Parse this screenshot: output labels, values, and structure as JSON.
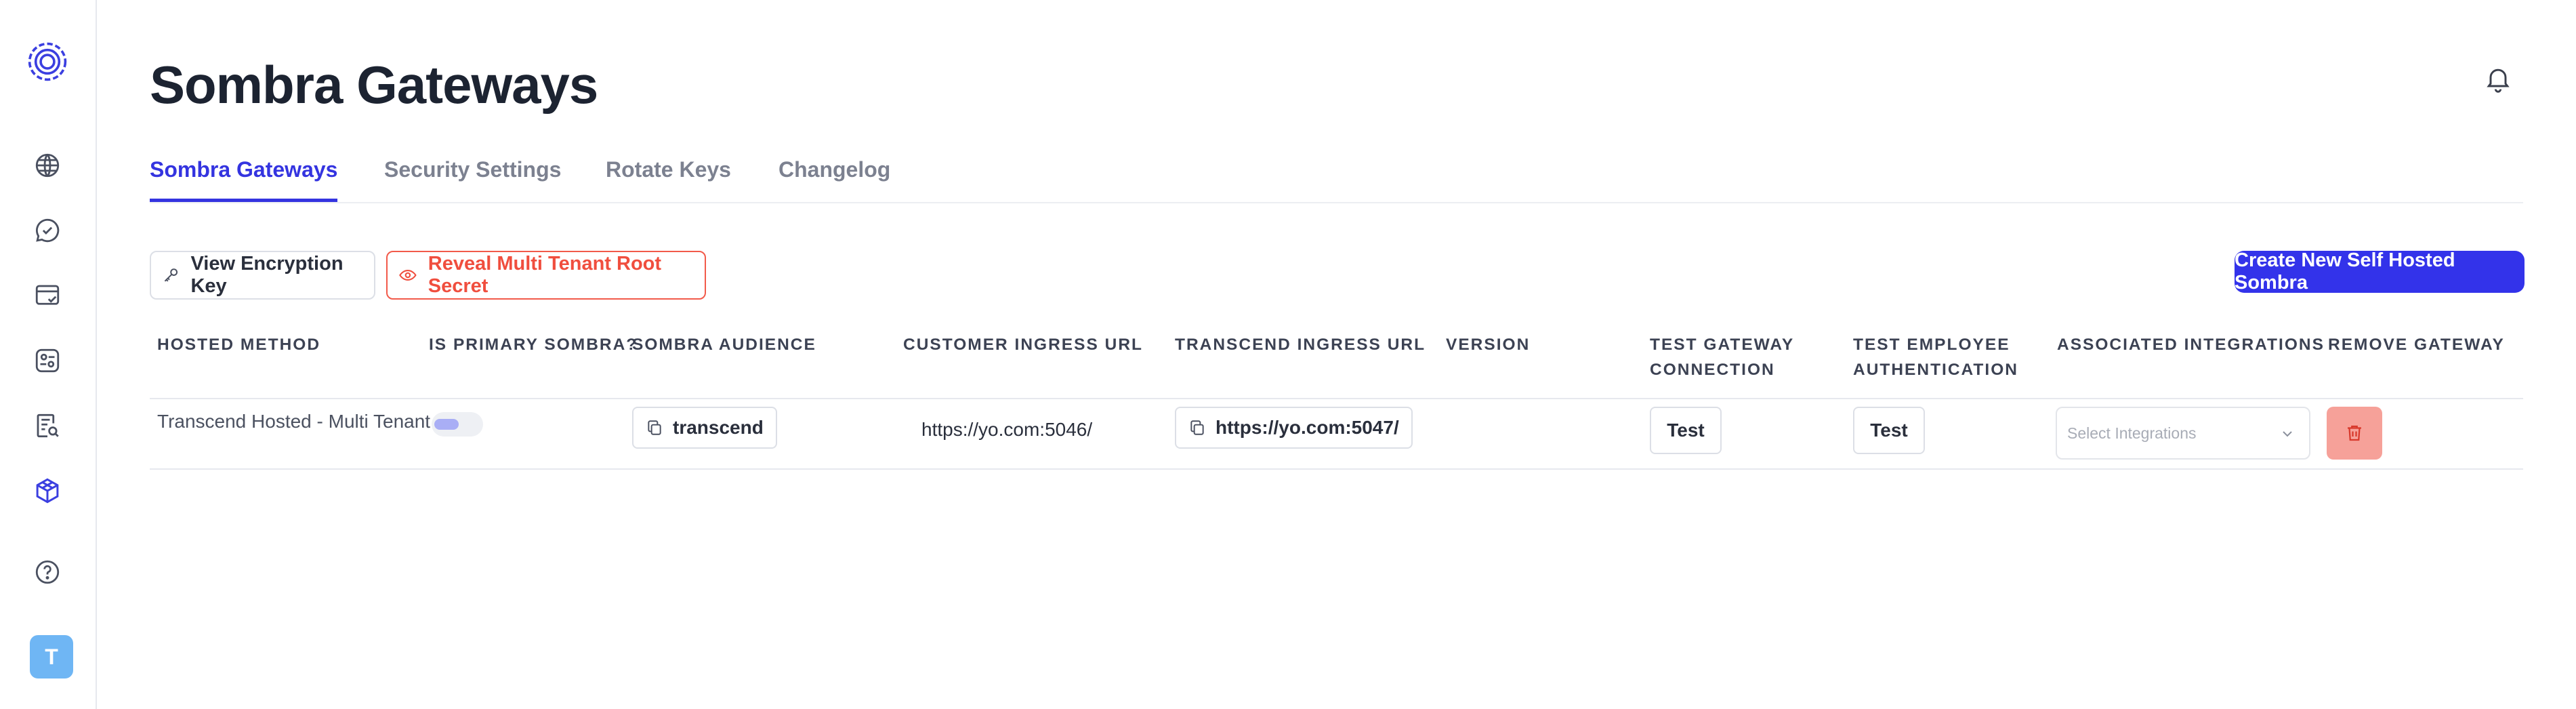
{
  "sidebar": {
    "logo": "sombra-logo-icon",
    "items": [
      {
        "icon": "globe-icon"
      },
      {
        "icon": "chat-check-icon"
      },
      {
        "icon": "browser-check-icon"
      },
      {
        "icon": "settings-card-icon"
      },
      {
        "icon": "document-search-icon"
      },
      {
        "icon": "cube-icon"
      },
      {
        "icon": "help-circle-icon"
      }
    ],
    "avatar_letter": "T",
    "avatar_color": "#6fb6f4"
  },
  "header": {
    "title": "Sombra Gateways",
    "notifications_icon": "bell-icon"
  },
  "tabs": [
    {
      "label": "Sombra Gateways",
      "active": true
    },
    {
      "label": "Security Settings",
      "active": false
    },
    {
      "label": "Rotate Keys",
      "active": false
    },
    {
      "label": "Changelog",
      "active": false
    }
  ],
  "actions": {
    "view_encryption_key": "View Encryption Key",
    "reveal_secret": "Reveal Multi Tenant Root Secret",
    "create_new": "Create New Self Hosted Sombra"
  },
  "table": {
    "columns": [
      "HOSTED METHOD",
      "IS PRIMARY SOMBRA?",
      "SOMBRA AUDIENCE",
      "CUSTOMER INGRESS URL",
      "TRANSCEND INGRESS URL",
      "VERSION",
      "TEST GATEWAY CONNECTION",
      "TEST EMPLOYEE AUTHENTICATION",
      "ASSOCIATED INTEGRATIONS",
      "REMOVE GATEWAY"
    ],
    "columns_split": {
      "test_gateway": [
        "TEST GATEWAY",
        "CONNECTION"
      ],
      "test_employee": [
        "TEST EMPLOYEE",
        "AUTHENTICATION"
      ]
    },
    "rows": [
      {
        "hosted_method": "Transcend Hosted - Multi Tenant",
        "is_primary": true,
        "audience": "transcend",
        "customer_ingress_url": "https://yo.com:5046/",
        "transcend_ingress_url": "https://yo.com:5047/",
        "version": "",
        "test_gateway_label": "Test",
        "test_employee_label": "Test",
        "integrations_placeholder": "Select Integrations"
      }
    ]
  },
  "colors": {
    "accent": "#3434e0",
    "primary_button": "#3333ea",
    "danger": "#f04e3e",
    "delete_bg": "#f6a199"
  }
}
